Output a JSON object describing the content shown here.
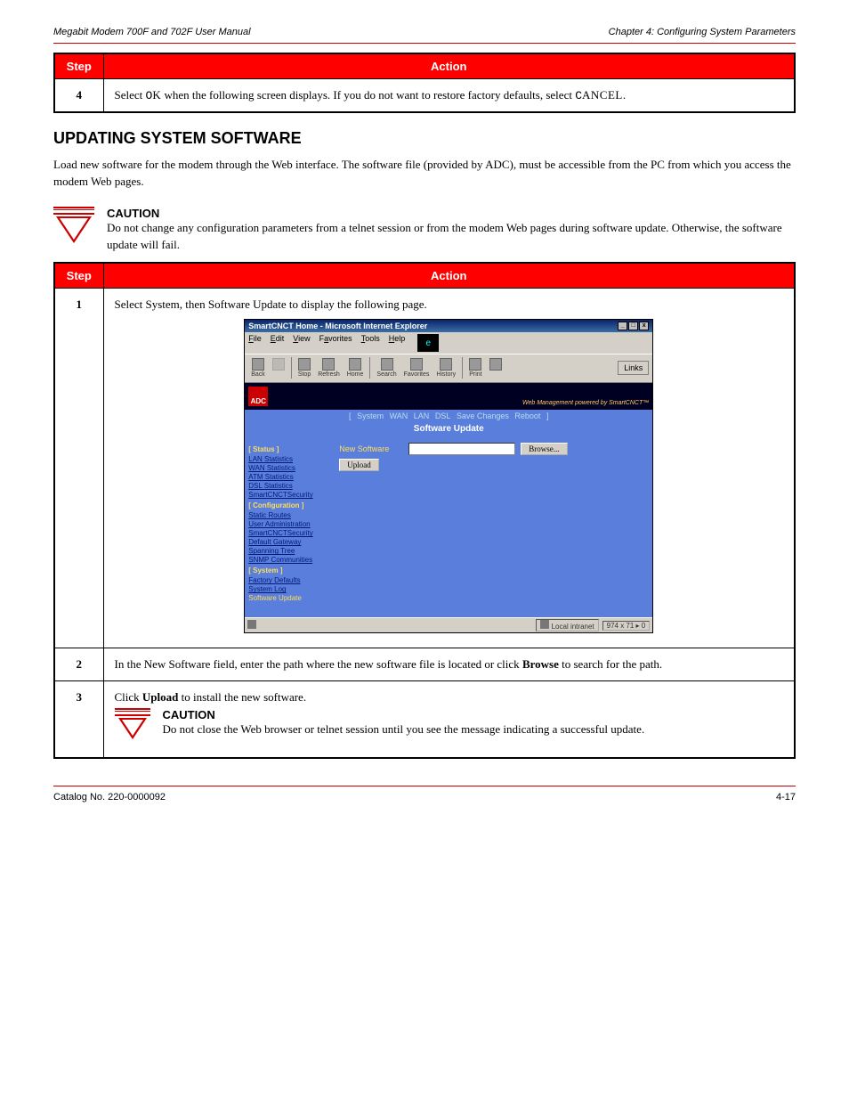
{
  "header": {
    "left": "Megabit Modem 700F and 702F User Manual",
    "right": "Chapter 4: Configuring System Parameters"
  },
  "footer": {
    "left": "Catalog No. 220-0000092",
    "right": "4-17"
  },
  "table1": {
    "headers": {
      "step": "Step",
      "action": "Action"
    },
    "row": {
      "num": "4",
      "text_a": "Select ",
      "text_o": "O",
      "text_k": "K",
      "text_b": " when the following screen displays. If you do not want to restore factory defaults, select ",
      "text_c": "C",
      "text_an": "ANCEL",
      "text_d": "."
    }
  },
  "section": {
    "title": "UPDATING SYSTEM SOFTWARE",
    "p1": "Load new software for the modem through the Web interface. The software file (provided by ADC), must be accessible from the PC from which you access the modem Web pages.",
    "caution1_label": "CAUTION",
    "caution1_text": "Do not change any configuration parameters from a telnet session or from the modem Web pages during software update. Otherwise, the software update will fail."
  },
  "table2": {
    "headers": {
      "step": "Step",
      "action": "Action"
    },
    "row1": {
      "num": "1",
      "text": "Select System, then Software Update to display the following page."
    },
    "row2": {
      "num": "2",
      "text_a": "In the New Software field, enter the path where the new software file is located or click ",
      "text_b": "Browse",
      "text_c": " to search for the path."
    },
    "row3": {
      "num": "3",
      "text_a": "Click ",
      "text_b": "Upload",
      "text_c": " to install the new software.",
      "caution_label": "CAUTION",
      "caution_text": "Do not close the Web browser or telnet session until you see the message indicating a successful update."
    }
  },
  "screenshot": {
    "title": "SmartCNCT Home - Microsoft Internet Explorer",
    "menu": {
      "file": "File",
      "edit": "Edit",
      "view": "View",
      "fav": "Favorites",
      "tools": "Tools",
      "help": "Help"
    },
    "toolbar": {
      "back": "Back",
      "stop": "Stop",
      "refresh": "Refresh",
      "home": "Home",
      "search": "Search",
      "favorites": "Favorites",
      "history": "History",
      "print": "Print"
    },
    "links": "Links",
    "adc": "ADC",
    "tagline": "Web Management powered by SmartCNCT™",
    "topnav": {
      "open": "[",
      "system": "System",
      "wan": "WAN",
      "lan": "LAN",
      "dsl": "DSL",
      "save": "Save Changes",
      "reboot": "Reboot",
      "close": "]"
    },
    "page_title": "Software Update",
    "sidebar": {
      "status": "[ Status ]",
      "lan_stats": "LAN Statistics",
      "wan_stats": "WAN Statistics",
      "atm_stats": "ATM Statistics",
      "dsl_stats": "DSL Statistics",
      "sec1": "SmartCNCTSecurity",
      "config": "[ Configuration ]",
      "static_routes": "Static Routes",
      "user_admin": "User Administration",
      "sec2": "SmartCNCTSecurity",
      "def_gw": "Default Gateway",
      "span_tree": "Spanning Tree",
      "snmp": "SNMP Communities",
      "system": "[ System ]",
      "factory": "Factory Defaults",
      "syslog": "System Log",
      "swupdate": "Software Update"
    },
    "form": {
      "label": "New Software",
      "browse": "Browse...",
      "upload": "Upload"
    },
    "status": {
      "left_icon": "document-icon",
      "zone": "Local intranet",
      "res": "974 x 71 ▸ 0"
    }
  }
}
